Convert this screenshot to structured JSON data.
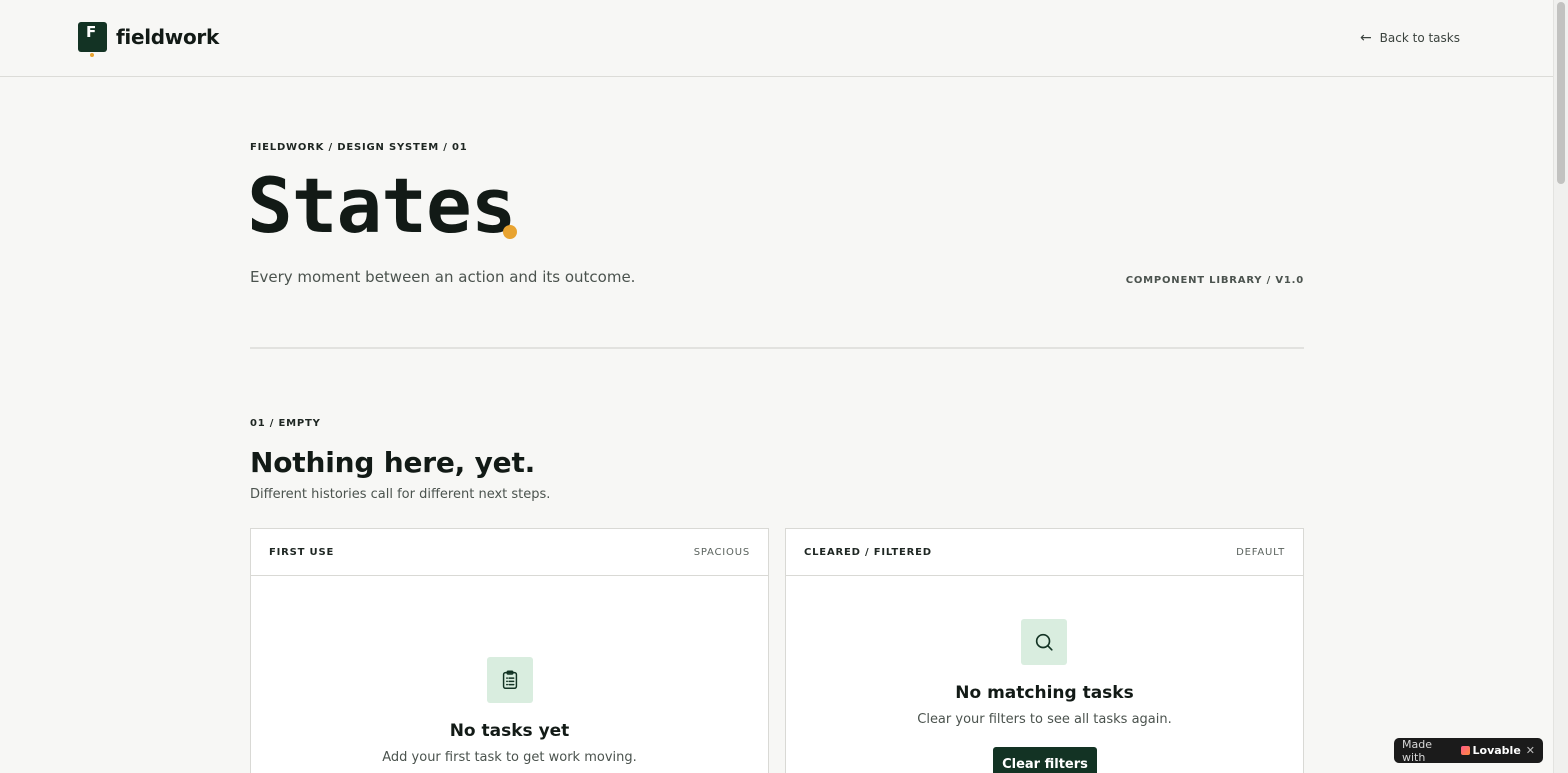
{
  "header": {
    "logo_letter": "F",
    "logo_text": "fieldwork",
    "back_label": "Back to tasks",
    "back_icon": "arrow-left-icon"
  },
  "hero": {
    "breadcrumb": "FIELDWORK / DESIGN SYSTEM / 01",
    "title": "States",
    "subtitle": "Every moment between an action and its outcome.",
    "library_tag": "COMPONENT LIBRARY / V1.0"
  },
  "section": {
    "eyebrow": "01 / EMPTY",
    "title": "Nothing here, yet.",
    "subtitle": "Different histories call for different next steps."
  },
  "cards": [
    {
      "name": "FIRST USE",
      "variant": "SPACIOUS",
      "icon": "clipboard-icon",
      "title": "No tasks yet",
      "subtitle": "Add your first task to get work moving."
    },
    {
      "name": "CLEARED / FILTERED",
      "variant": "DEFAULT",
      "icon": "search-icon",
      "title": "No matching tasks",
      "subtitle": "Clear your filters to see all tasks again.",
      "button_label": "Clear filters"
    }
  ],
  "badge": {
    "made_with": "Made with",
    "brand": "Lovable",
    "close_icon": "close-icon"
  },
  "colors": {
    "brand_green": "#133324",
    "accent_orange": "#e8a330",
    "icon_bg": "#d9eddf",
    "page_bg": "#f7f7f5"
  }
}
